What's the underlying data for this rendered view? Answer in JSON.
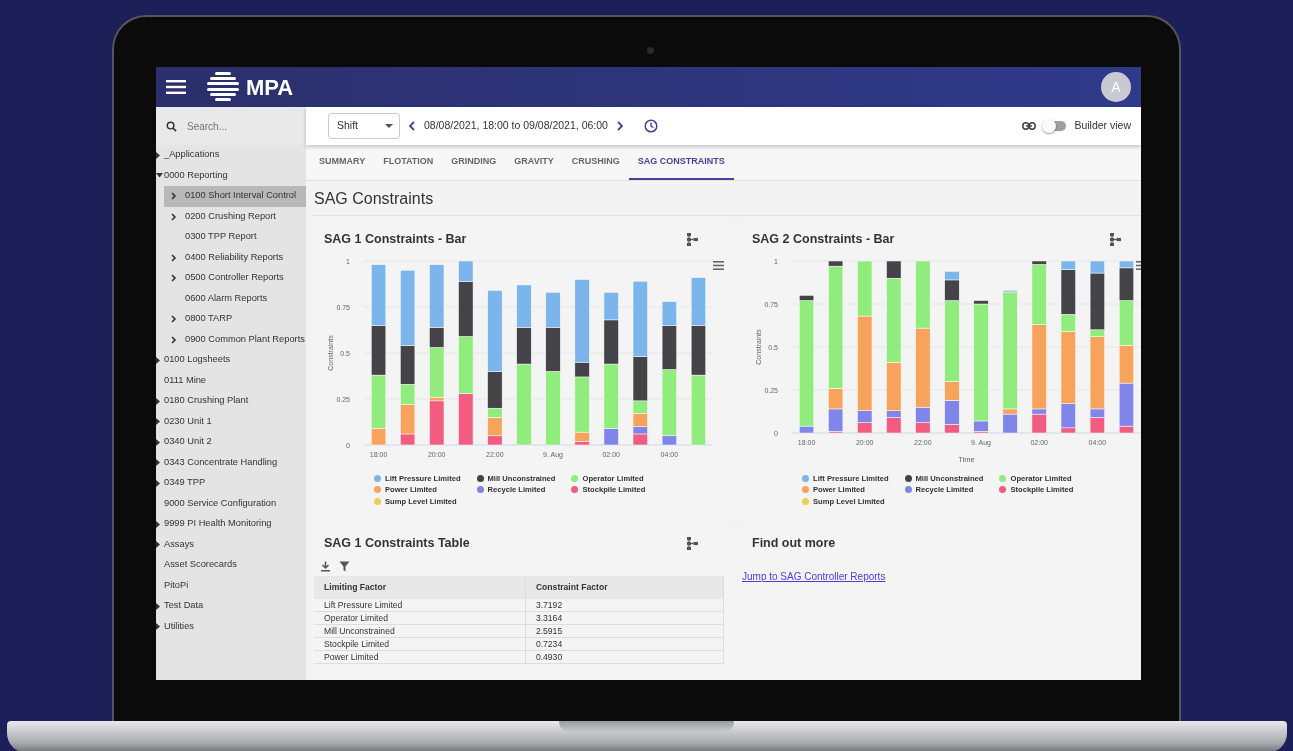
{
  "header": {
    "logo_text": "MPA",
    "avatar_initial": "A"
  },
  "sidebar": {
    "search": {
      "placeholder": "Search..."
    },
    "items": [
      {
        "label": "_Applications",
        "kind": "folder",
        "expanded": false,
        "selected": false
      },
      {
        "label": "0000 Reporting",
        "kind": "folder",
        "expanded": true,
        "selected": false,
        "children": [
          {
            "label": "0100 Short Interval Control",
            "kind": "folder",
            "expanded": false,
            "selected": true
          },
          {
            "label": "0200 Crushing Report",
            "kind": "folder",
            "expanded": false,
            "selected": false
          },
          {
            "label": "0300 TPP Report",
            "kind": "leaf",
            "selected": false
          },
          {
            "label": "0400 Reliability Reports",
            "kind": "folder",
            "expanded": false,
            "selected": false
          },
          {
            "label": "0500 Controller Reports",
            "kind": "folder",
            "expanded": false,
            "selected": false
          },
          {
            "label": "0600 Alarm Reports",
            "kind": "leaf",
            "selected": false
          },
          {
            "label": "0800 TARP",
            "kind": "folder",
            "expanded": false,
            "selected": false
          },
          {
            "label": "0900 Common Plant Reports",
            "kind": "folder",
            "expanded": false,
            "selected": false
          }
        ]
      },
      {
        "label": "0100 Logsheets",
        "kind": "folder",
        "expanded": false,
        "selected": false
      },
      {
        "label": "0111 Mine",
        "kind": "leaf",
        "selected": false
      },
      {
        "label": "0180 Crushing Plant",
        "kind": "folder",
        "expanded": false,
        "selected": false
      },
      {
        "label": "0230 Unit 1",
        "kind": "folder",
        "expanded": false,
        "selected": false
      },
      {
        "label": "0340 Unit 2",
        "kind": "folder",
        "expanded": false,
        "selected": false
      },
      {
        "label": "0343 Concentrate Handling",
        "kind": "folder",
        "expanded": false,
        "selected": false
      },
      {
        "label": "0349 TPP",
        "kind": "folder",
        "expanded": false,
        "selected": false
      },
      {
        "label": "9000 Service Configuration",
        "kind": "leaf",
        "selected": false
      },
      {
        "label": "9999 PI Health Monitoring",
        "kind": "folder",
        "expanded": false,
        "selected": false
      },
      {
        "label": "Assays",
        "kind": "folder",
        "expanded": false,
        "selected": false
      },
      {
        "label": "Asset Scorecards",
        "kind": "leaf",
        "selected": false
      },
      {
        "label": "PitoPi",
        "kind": "leaf",
        "selected": false
      },
      {
        "label": "Test Data",
        "kind": "folder",
        "expanded": false,
        "selected": false
      },
      {
        "label": "Utilities",
        "kind": "folder",
        "expanded": false,
        "selected": false
      }
    ]
  },
  "toolbar": {
    "period": "Shift",
    "date_range": "08/08/2021, 18:00 to 09/08/2021, 06:00",
    "builder_view": {
      "label": "Builder view",
      "on": false
    }
  },
  "tabs": [
    {
      "label": "SUMMARY",
      "selected": false
    },
    {
      "label": "FLOTATION",
      "selected": false
    },
    {
      "label": "GRINDING",
      "selected": false
    },
    {
      "label": "GRAVITY",
      "selected": false
    },
    {
      "label": "CRUSHING",
      "selected": false
    },
    {
      "label": "SAG CONSTRAINTS",
      "selected": true
    }
  ],
  "page_title": "SAG Constraints",
  "chart_cards": [
    {
      "title": "SAG 1 Constraints - Bar",
      "chart_data": {
        "type": "bar",
        "stacked": true,
        "grid": true,
        "ylabel": "Constraints",
        "categories": [
          "18:00",
          null,
          "20:00",
          null,
          "22:00",
          null,
          "9. Aug",
          null,
          "02:00",
          null,
          "04:00",
          null
        ],
        "ylim": [
          0,
          1
        ],
        "yticks": [
          0,
          0.25,
          0.5,
          0.75,
          1
        ],
        "series": [
          {
            "name": "Lift Pressure Limited",
            "color": "#7cb5ec",
            "values": [
              0.33,
              0.41,
              0.34,
              0.11,
              0.44,
              0.23,
              0.19,
              0.45,
              0.15,
              0.41,
              0.13,
              0.26
            ]
          },
          {
            "name": "Mill Unconstrained",
            "color": "#434348",
            "values": [
              0.27,
              0.21,
              0.11,
              0.3,
              0.2,
              0.2,
              0.24,
              0.08,
              0.24,
              0.24,
              0.24,
              0.27
            ]
          },
          {
            "name": "Operator Limited",
            "color": "#90ed7d",
            "values": [
              0.29,
              0.11,
              0.27,
              0.31,
              0.05,
              0.44,
              0.4,
              0.3,
              0.35,
              0.07,
              0.36,
              0.38
            ]
          },
          {
            "name": "Power Limited",
            "color": "#f7a35c",
            "values": [
              0.09,
              0.16,
              0.02,
              0,
              0.1,
              0,
              0,
              0.05,
              0,
              0.07,
              0,
              0
            ]
          },
          {
            "name": "Recycle Limited",
            "color": "#8085e9",
            "values": [
              0,
              0,
              0,
              0,
              0,
              0,
              0,
              0,
              0.09,
              0.04,
              0.05,
              0
            ]
          },
          {
            "name": "Stockpile Limited",
            "color": "#f15c80",
            "values": [
              0,
              0.06,
              0.24,
              0.28,
              0.05,
              0,
              0,
              0.02,
              0,
              0.06,
              0,
              0
            ]
          },
          {
            "name": "Sump Level Limited",
            "color": "#e4d354",
            "values": [
              0,
              0,
              0,
              0,
              0,
              0,
              0,
              0,
              0,
              0,
              0,
              0
            ]
          }
        ]
      }
    },
    {
      "title": "SAG 2 Constraints - Bar",
      "chart_data": {
        "type": "bar",
        "stacked": true,
        "grid": true,
        "xlabel": "Time",
        "ylabel": "Constraints",
        "categories": [
          "18:00",
          null,
          "20:00",
          null,
          "22:00",
          null,
          "9. Aug",
          null,
          "02:00",
          null,
          "04:00",
          null
        ],
        "ylim": [
          0,
          1
        ],
        "yticks": [
          0,
          0.25,
          0.5,
          0.75,
          1
        ],
        "series": [
          {
            "name": "Lift Pressure Limited",
            "color": "#7cb5ec",
            "values": [
              0,
              0,
              0,
              0,
              0,
              0.05,
              0,
              0.01,
              0,
              0.05,
              0.07,
              0.04
            ]
          },
          {
            "name": "Mill Unconstrained",
            "color": "#434348",
            "values": [
              0.03,
              0.03,
              0,
              0.1,
              0,
              0.12,
              0.02,
              0,
              0.02,
              0.26,
              0.33,
              0.19
            ]
          },
          {
            "name": "Operator Limited",
            "color": "#90ed7d",
            "values": [
              0.73,
              0.71,
              0.32,
              0.49,
              0.39,
              0.47,
              0.68,
              0.68,
              0.35,
              0.1,
              0.04,
              0.26
            ]
          },
          {
            "name": "Power Limited",
            "color": "#f7a35c",
            "values": [
              0,
              0.12,
              0.55,
              0.28,
              0.46,
              0.11,
              0,
              0.03,
              0.49,
              0.42,
              0.42,
              0.22
            ]
          },
          {
            "name": "Recycle Limited",
            "color": "#8085e9",
            "values": [
              0.04,
              0.13,
              0.07,
              0.04,
              0.09,
              0.14,
              0.06,
              0.11,
              0.03,
              0.14,
              0.05,
              0.25
            ]
          },
          {
            "name": "Stockpile Limited",
            "color": "#f15c80",
            "values": [
              0,
              0.01,
              0.06,
              0.09,
              0.06,
              0.05,
              0.01,
              0,
              0.11,
              0.03,
              0.09,
              0.04
            ]
          },
          {
            "name": "Sump Level Limited",
            "color": "#e4d354",
            "values": [
              0,
              0,
              0,
              0,
              0,
              0,
              0,
              0,
              0,
              0,
              0,
              0
            ]
          }
        ]
      }
    }
  ],
  "table_card": {
    "title": "SAG 1 Constraints Table",
    "columns": [
      "Limiting Factor",
      "Constraint Factor"
    ],
    "rows": [
      [
        "Lift Pressure Limited",
        "3.7192"
      ],
      [
        "Operator Limited",
        "3.3164"
      ],
      [
        "Mill Unconstrained",
        "2.5915"
      ],
      [
        "Stockpile Limited",
        "0.7234"
      ],
      [
        "Power Limited",
        "0.4930"
      ]
    ]
  },
  "links_card": {
    "title": "Find out more",
    "link": "Jump to SAG Controller Reports"
  }
}
